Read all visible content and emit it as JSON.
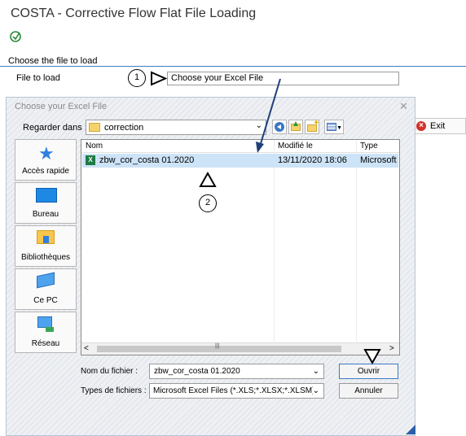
{
  "app": {
    "title": "COSTA - Corrective Flow Flat File Loading",
    "section_title": "Choose the file to load",
    "file_label": "File to load",
    "file_field_value": "Choose your Excel File",
    "exit_label": "Exit"
  },
  "dialog": {
    "title": "Choose your Excel File",
    "close_glyph": "✕",
    "look_in_label": "Regarder dans :",
    "look_in_value": "correction",
    "places": [
      {
        "label": "Accès rapide",
        "icon": "quick-access-star-icon"
      },
      {
        "label": "Bureau",
        "icon": "desktop-icon"
      },
      {
        "label": "Bibliothèques",
        "icon": "libraries-icon"
      },
      {
        "label": "Ce PC",
        "icon": "this-pc-icon"
      },
      {
        "label": "Réseau",
        "icon": "network-icon"
      }
    ],
    "columns": {
      "name": "Nom",
      "date": "Modifié le",
      "type": "Type"
    },
    "files": [
      {
        "name": "zbw_cor_costa 01.2020",
        "date": "13/11/2020 18:06",
        "type": "Microsoft"
      }
    ],
    "scroll_left": "<",
    "scroll_right": ">",
    "scroll_thumb_mark": "|||",
    "filename_label": "Nom du fichier :",
    "filename_value": "zbw_cor_costa 01.2020",
    "filetype_label": "Types de fichiers :",
    "filetype_value": "Microsoft Excel Files (*.XLS;*.XLSX;*.XLSM)",
    "open_label": "Ouvrir",
    "cancel_label": "Annuler"
  },
  "annotations": {
    "step1": "1",
    "step2": "2"
  },
  "colors": {
    "accent": "#3f7fc4",
    "selection": "#cde3f7",
    "exit_red": "#d3312b",
    "annotation_arrow": "#1f3f7a"
  }
}
